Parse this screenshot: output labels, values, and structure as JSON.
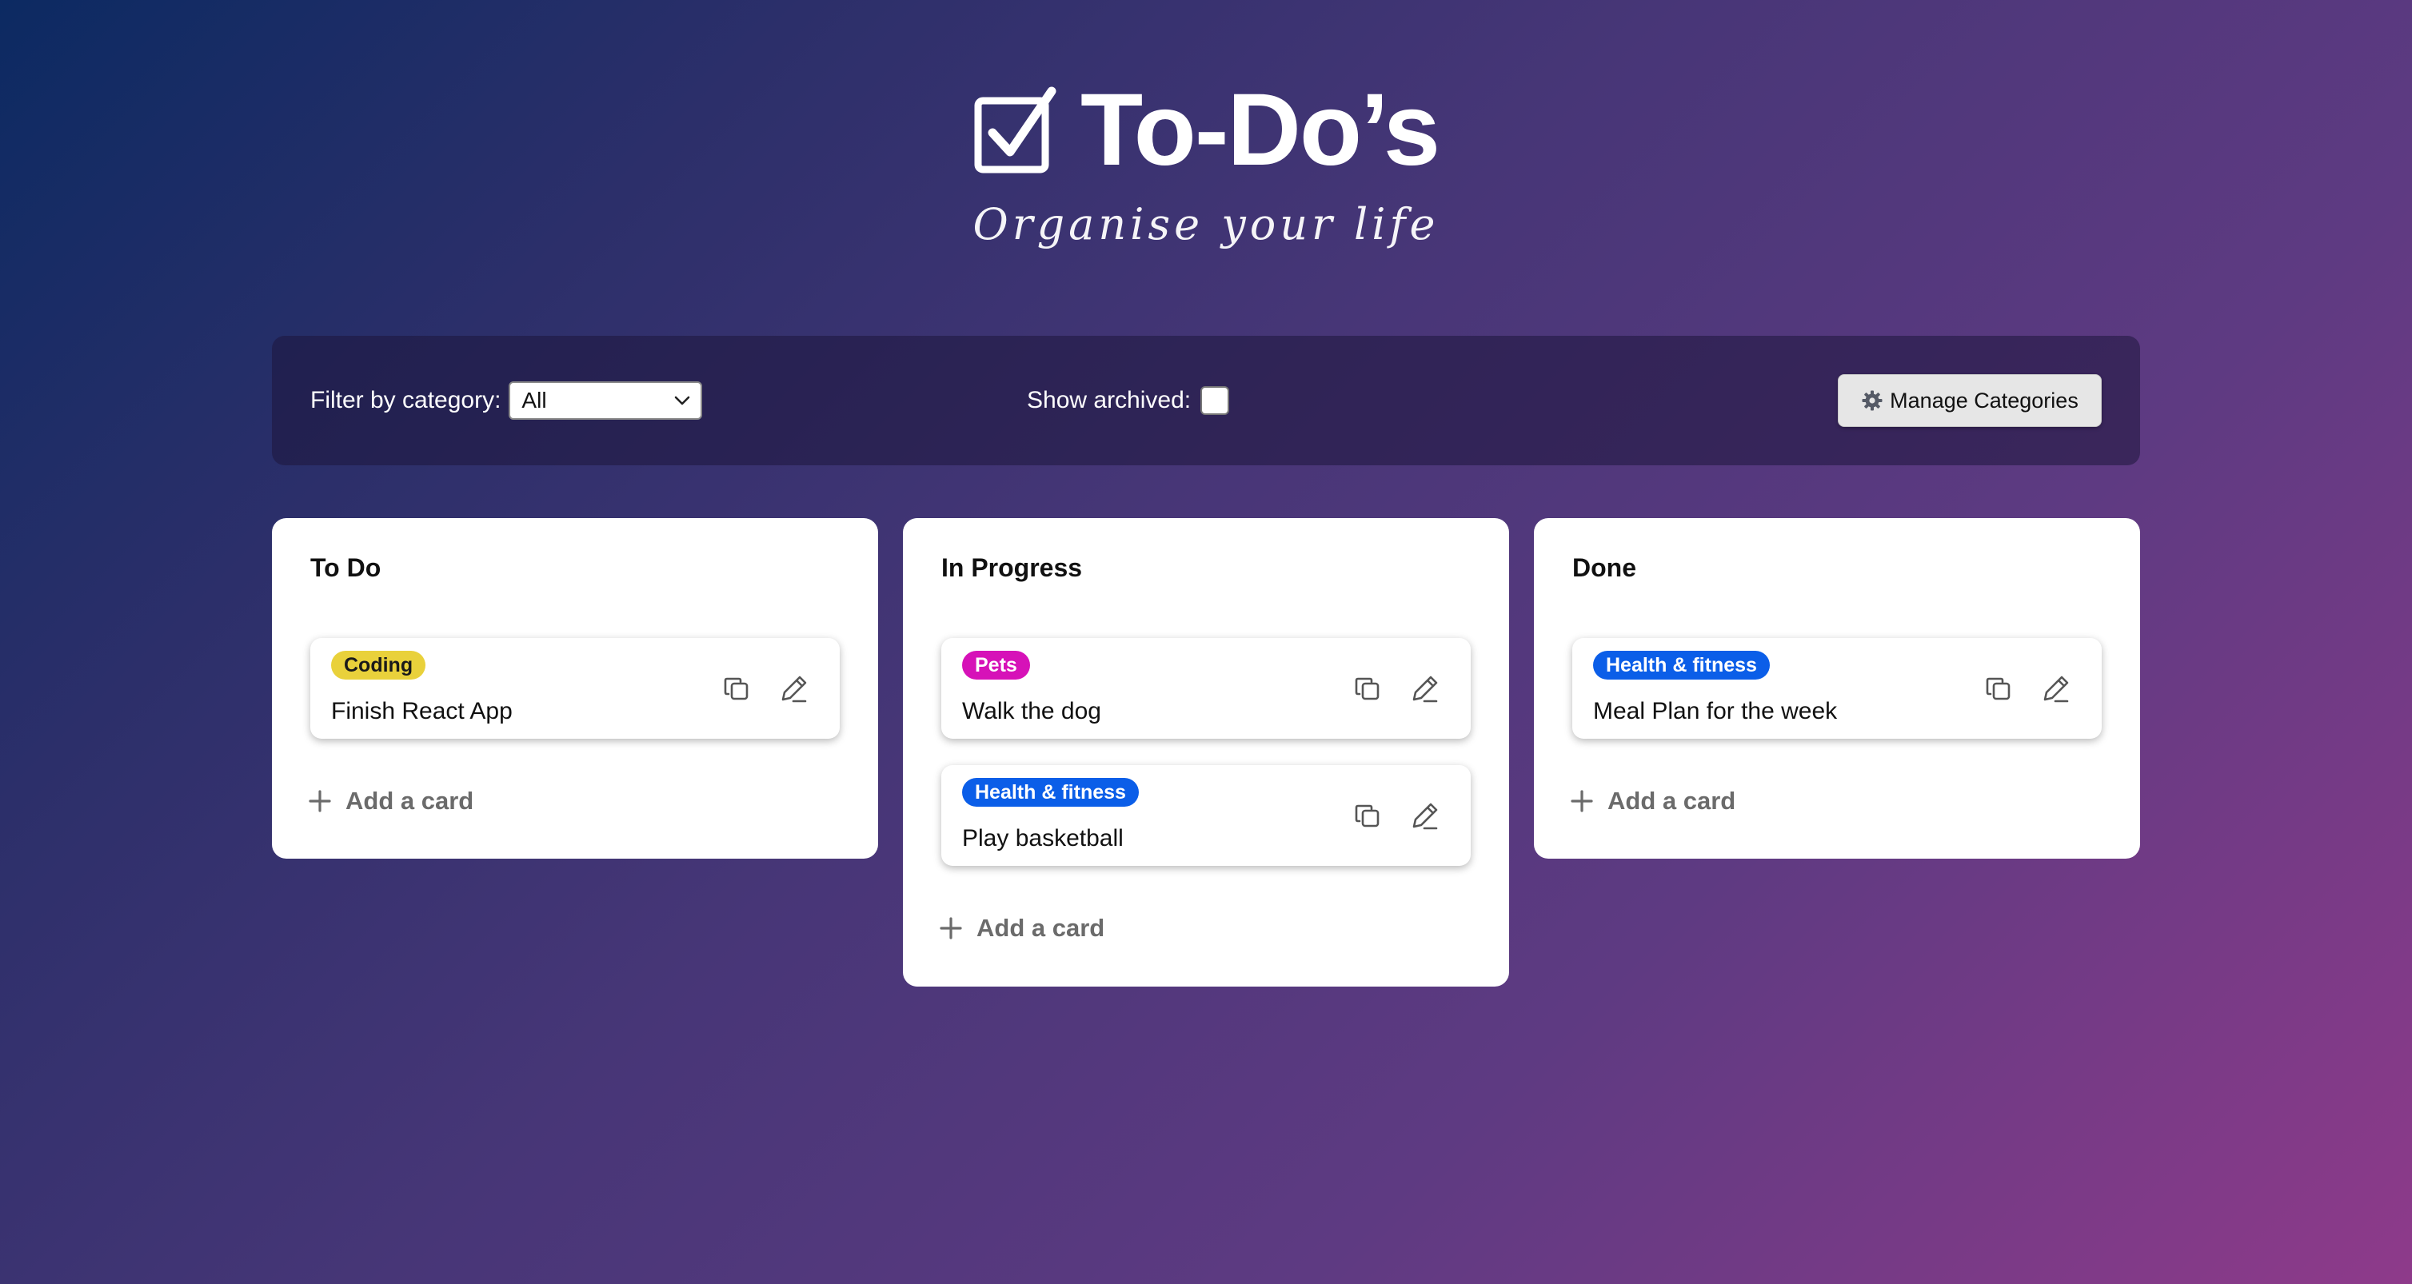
{
  "header": {
    "title": "To-Do’s",
    "subtitle": "Organise your life"
  },
  "toolbar": {
    "filter_label": "Filter by category:",
    "filter_value": "All",
    "archived_label": "Show archived:",
    "archived_checked": false,
    "manage_label": "Manage Categories"
  },
  "columns": [
    {
      "title": "To Do",
      "cards": [
        {
          "tag": "Coding",
          "text": "Finish React App"
        }
      ],
      "add_label": "Add a card"
    },
    {
      "title": "In Progress",
      "cards": [
        {
          "tag": "Pets",
          "text": "Walk the dog"
        },
        {
          "tag": "Health & fitness",
          "text": "Play basketball"
        }
      ],
      "add_label": "Add a card"
    },
    {
      "title": "Done",
      "cards": [
        {
          "tag": "Health & fitness",
          "text": "Meal Plan for the week"
        }
      ],
      "add_label": "Add a card"
    }
  ],
  "tag_colors": {
    "Coding": "#e9d13b",
    "Pets": "#d612b8",
    "Health & fitness": "#0b5ee8"
  },
  "icons": {
    "title": "checkbox-check-icon",
    "manage": "gear-icon",
    "copy": "copy-icon",
    "edit": "pencil-icon",
    "add": "plus-icon"
  }
}
